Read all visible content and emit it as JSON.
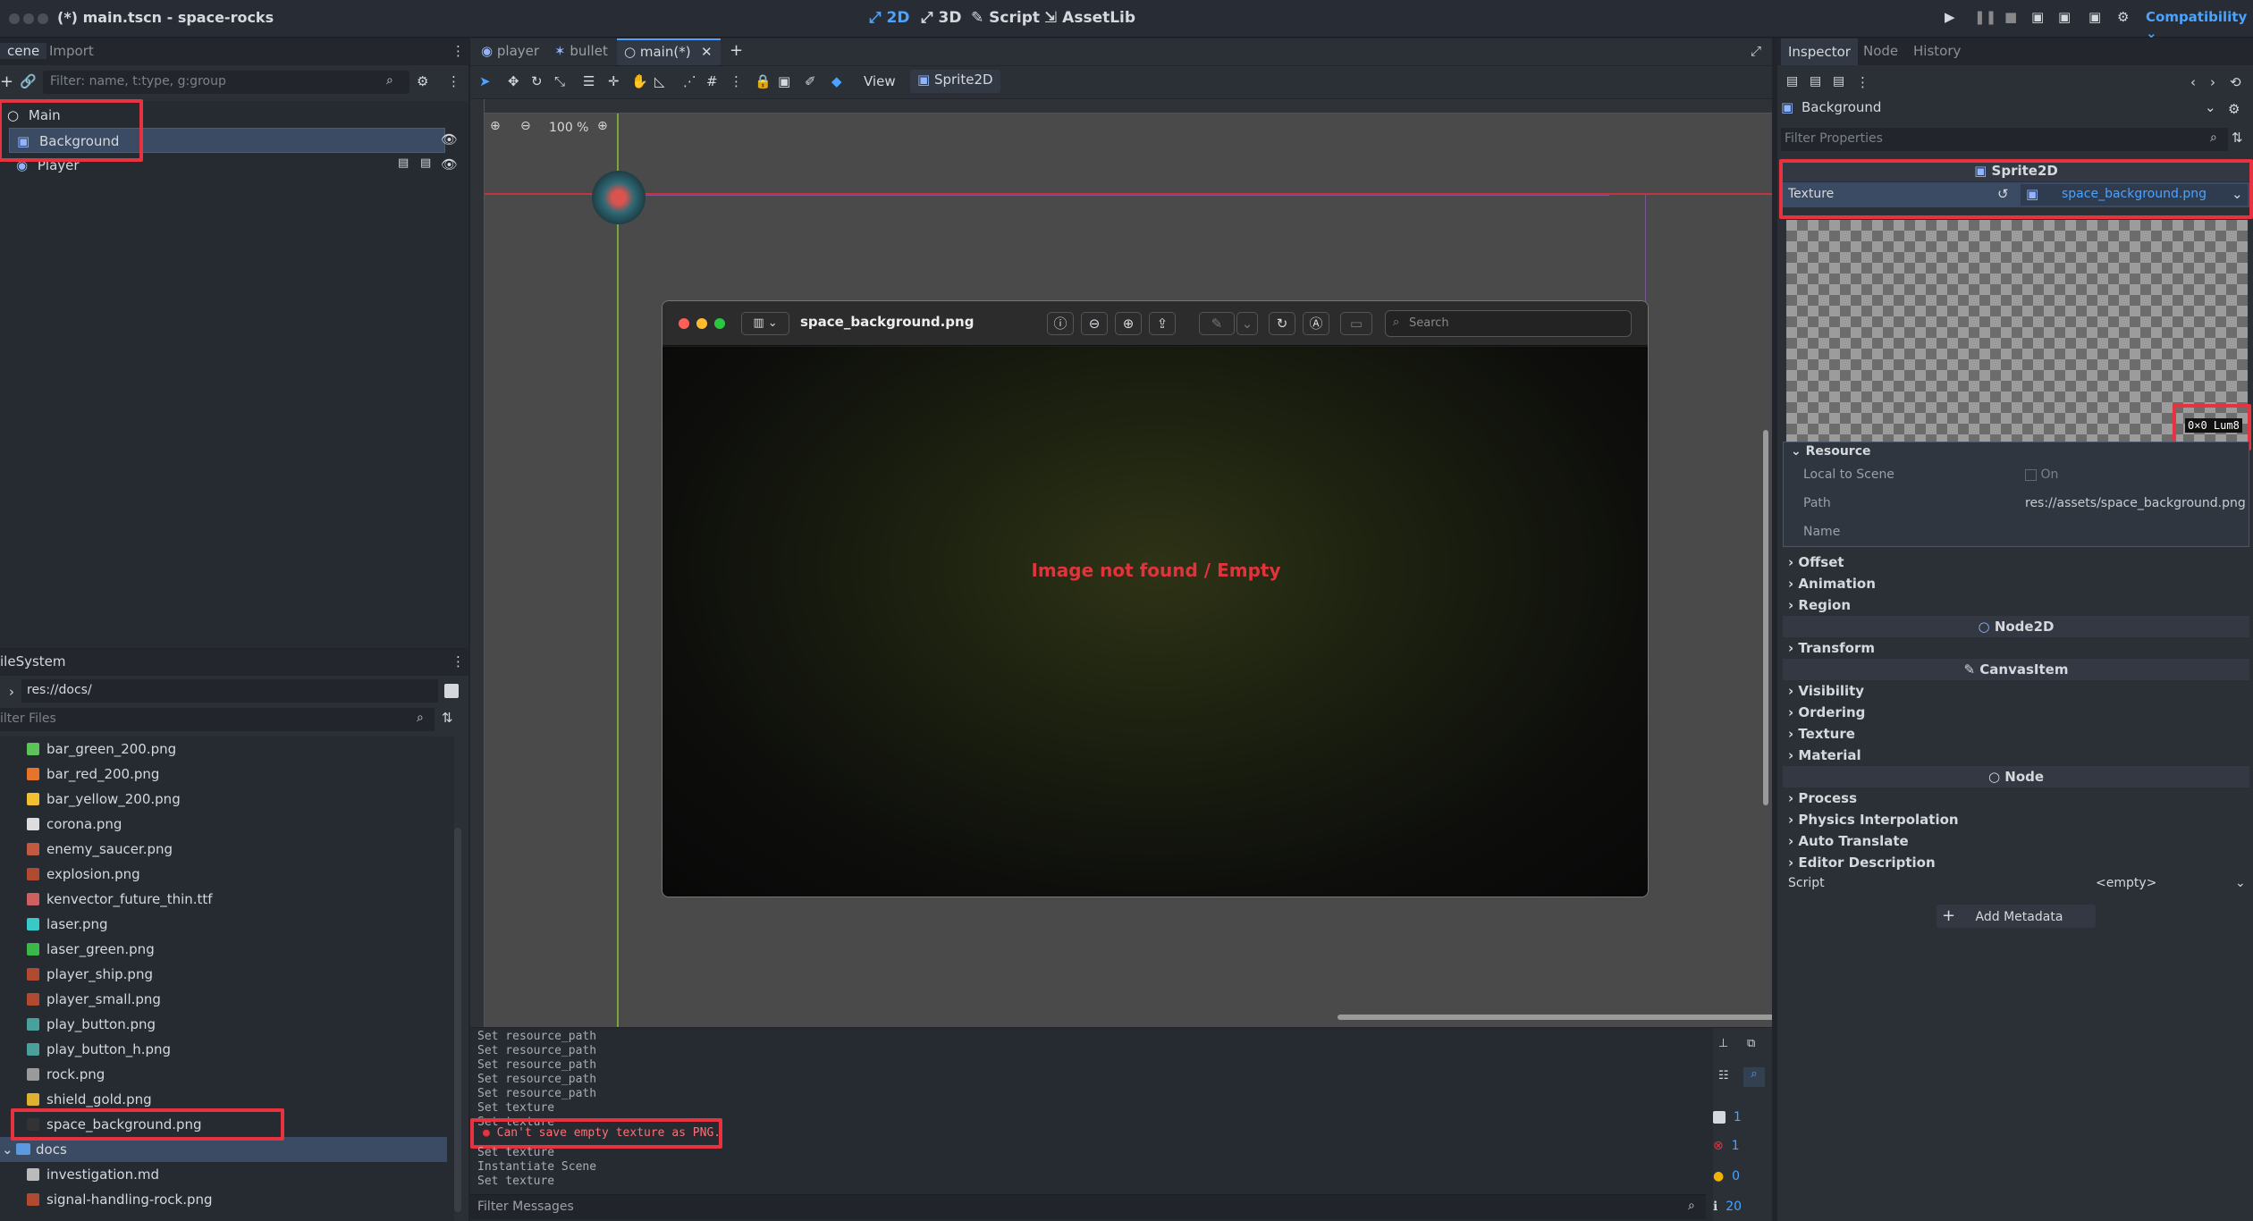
{
  "title": "(*) main.tscn - space-rocks",
  "modes": [
    "2D",
    "3D",
    "Script",
    "AssetLib"
  ],
  "renderer": "Compatibility",
  "scene_dock": {
    "tabs": [
      "cene",
      "Import"
    ],
    "filter_placeholder": "Filter: name, t:type, g:group",
    "nodes": [
      {
        "label": "Main"
      },
      {
        "label": "Background"
      },
      {
        "label": "Player"
      }
    ]
  },
  "filesystem": {
    "title": "ileSystem",
    "path": "res://docs/",
    "filter_placeholder": "ilter Files",
    "files": [
      "bar_green_200.png",
      "bar_red_200.png",
      "bar_yellow_200.png",
      "corona.png",
      "enemy_saucer.png",
      "explosion.png",
      "kenvector_future_thin.ttf",
      "laser.png",
      "laser_green.png",
      "player_ship.png",
      "player_small.png",
      "play_button.png",
      "play_button_h.png",
      "rock.png",
      "shield_gold.png",
      "space_background.png"
    ],
    "folder": "docs",
    "docs_files": [
      "investigation.md",
      "signal-handling-rock.png"
    ]
  },
  "editor_tabs": [
    "player",
    "bullet",
    "main(*)"
  ],
  "toolbar": {
    "view": "View",
    "sprite": "Sprite2D"
  },
  "zoom": "100 %",
  "preview": {
    "filename": "space_background.png",
    "search_placeholder": "Search",
    "message": "Image not found / Empty"
  },
  "output": {
    "lines": [
      "Set resource_path",
      "Set resource_path",
      "Set resource_path",
      "Set resource_path",
      "Set resource_path",
      "Set texture",
      "Set texture"
    ],
    "error": "Can't save empty texture as PNG.",
    "lines2": [
      "Set texture",
      "Instantiate Scene",
      "Set texture"
    ],
    "filter_placeholder": "Filter Messages",
    "counts": [
      "1",
      "1",
      "0",
      "20"
    ]
  },
  "inspector": {
    "tabs": [
      "Inspector",
      "Node",
      "History"
    ],
    "node": "Background",
    "filter_placeholder": "Filter Properties",
    "class_sprite": "Sprite2D",
    "texture_label": "Texture",
    "texture_value": "space_background.png",
    "size_label": "0×0 Lum8",
    "resource": "Resource",
    "local_to_scene": "Local to Scene",
    "on": "On",
    "path_label": "Path",
    "path_value": "res://assets/space_background.png",
    "name_label": "Name",
    "sprite_sections": [
      "Offset",
      "Animation",
      "Region"
    ],
    "class_node2d": "Node2D",
    "node2d_sections": [
      "Transform"
    ],
    "class_canvas": "CanvasItem",
    "canvas_sections": [
      "Visibility",
      "Ordering",
      "Texture",
      "Material"
    ],
    "class_node": "Node",
    "node_sections": [
      "Process",
      "Physics Interpolation",
      "Auto Translate",
      "Editor Description"
    ],
    "script_label": "Script",
    "script_value": "<empty>",
    "add_metadata": "Add Metadata"
  },
  "colors": {
    "accent": "#4aa3ff",
    "error": "#e6333f",
    "selection": "#3b4b63"
  }
}
